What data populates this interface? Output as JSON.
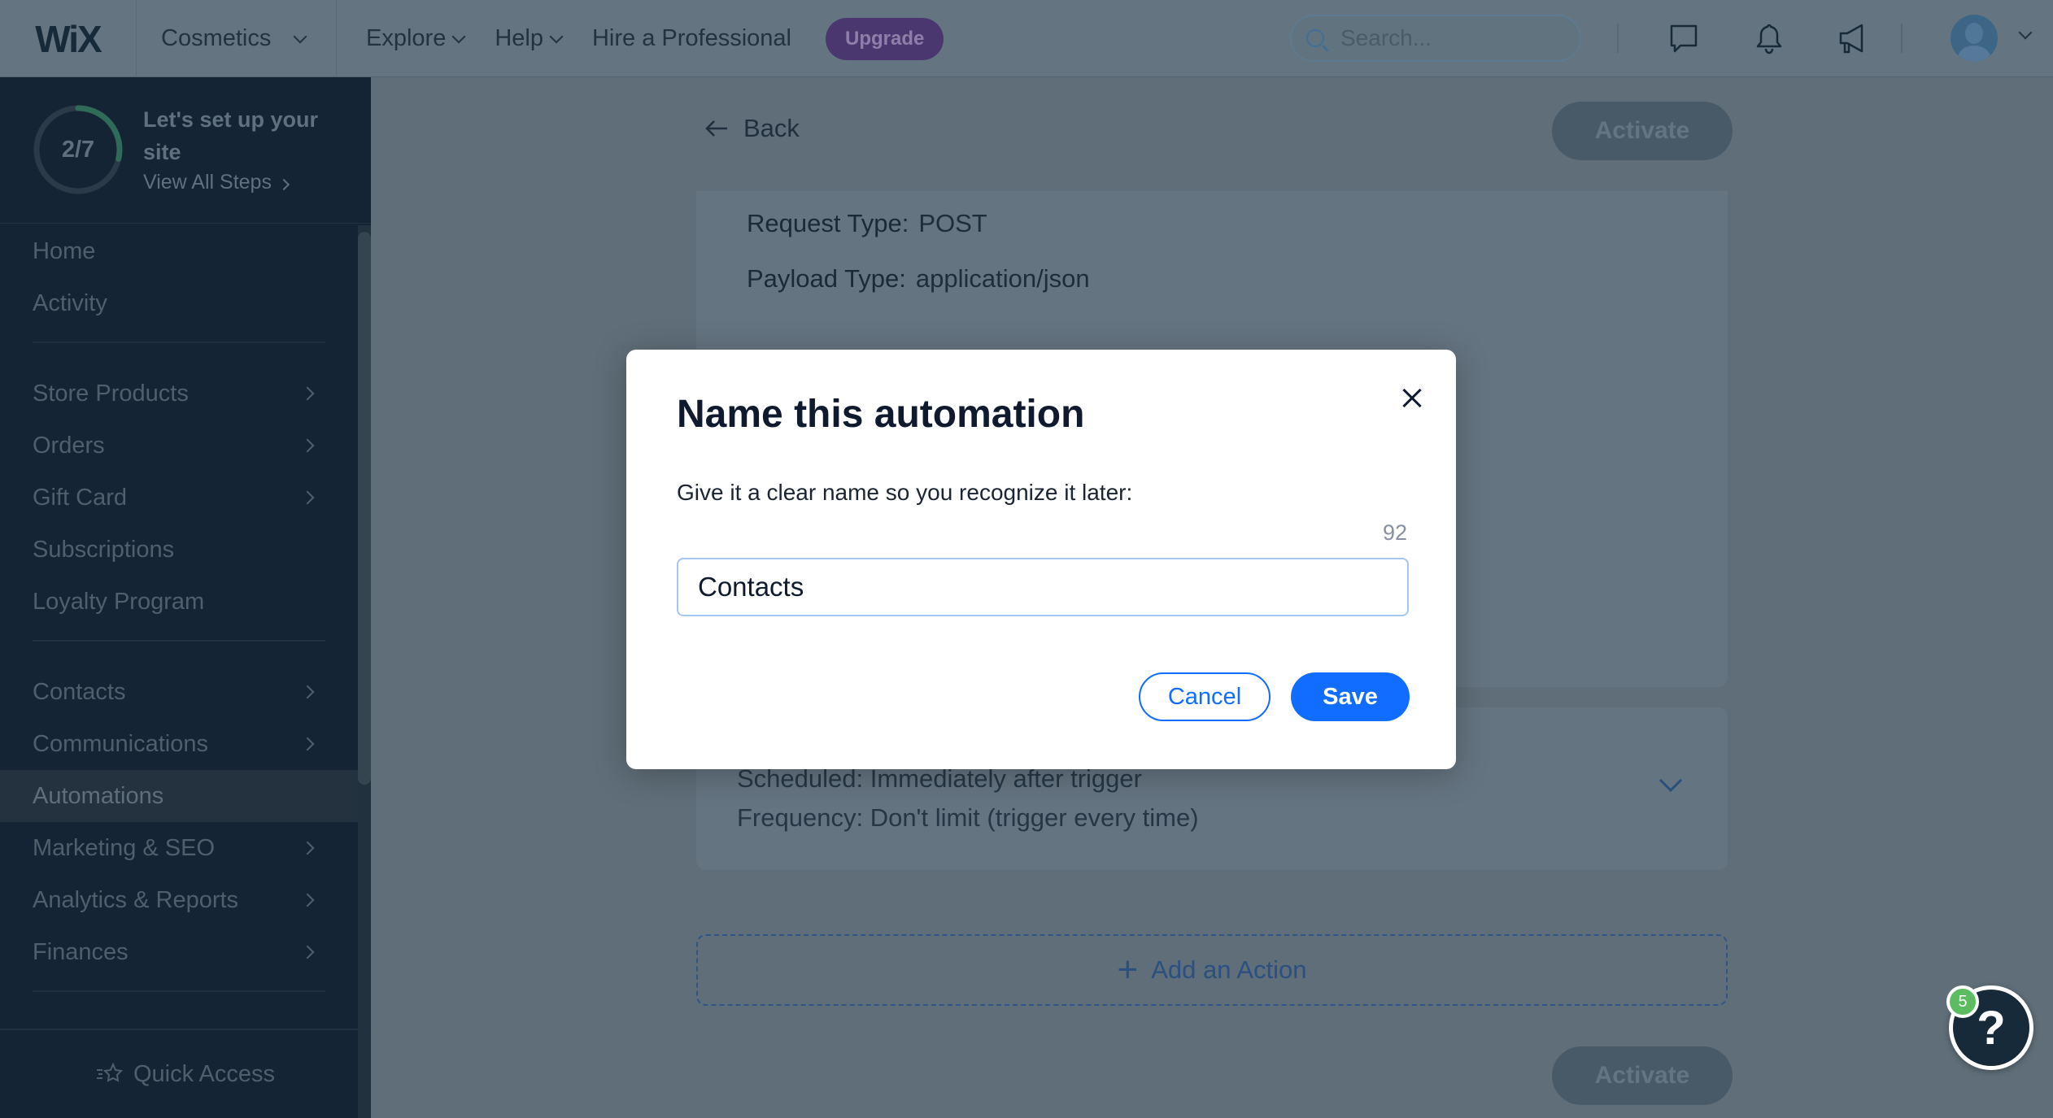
{
  "topbar": {
    "logo": "WiX",
    "site_name": "Cosmetics",
    "nav": [
      {
        "label": "Explore",
        "has_dropdown": true
      },
      {
        "label": "Help",
        "has_dropdown": true
      },
      {
        "label": "Hire a Professional",
        "has_dropdown": false
      }
    ],
    "upgrade_label": "Upgrade",
    "search_placeholder": "Search...",
    "icons": [
      "chat-icon",
      "bell-icon",
      "megaphone-icon",
      "avatar"
    ]
  },
  "sidebar": {
    "setup": {
      "progress_text": "2/7",
      "progress_fraction": 0.2857,
      "title": "Let's set up your site",
      "link_label": "View All Steps"
    },
    "groups": [
      [
        {
          "label": "Home",
          "has_submenu": false
        },
        {
          "label": "Activity",
          "has_submenu": false
        }
      ],
      [
        {
          "label": "Store Products",
          "has_submenu": true
        },
        {
          "label": "Orders",
          "has_submenu": true
        },
        {
          "label": "Gift Card",
          "has_submenu": true
        },
        {
          "label": "Subscriptions",
          "has_submenu": false
        },
        {
          "label": "Loyalty Program",
          "has_submenu": false
        }
      ],
      [
        {
          "label": "Contacts",
          "has_submenu": true
        },
        {
          "label": "Communications",
          "has_submenu": true
        },
        {
          "label": "Automations",
          "has_submenu": false,
          "active": true
        },
        {
          "label": "Marketing & SEO",
          "has_submenu": true
        },
        {
          "label": "Analytics & Reports",
          "has_submenu": true
        },
        {
          "label": "Finances",
          "has_submenu": true
        }
      ]
    ],
    "quick_access_label": "Quick Access"
  },
  "main": {
    "back_label": "Back",
    "activate_label": "Activate",
    "request_type_label": "Request Type:",
    "request_type_value": "POST",
    "payload_type_label": "Payload Type:",
    "payload_type_value": "application/json",
    "scheduled_text": "Scheduled: Immediately after trigger",
    "frequency_text": "Frequency: Don't limit (trigger every time)",
    "add_action_label": "Add an Action"
  },
  "help": {
    "badge_count": "5",
    "glyph": "?"
  },
  "modal": {
    "title": "Name this automation",
    "description": "Give it a clear name so you recognize it later:",
    "char_remaining": "92",
    "input_value": "Contacts",
    "cancel_label": "Cancel",
    "save_label": "Save"
  },
  "colors": {
    "primary": "#116dff",
    "upgrade": "#4b3770",
    "sidebar_bg": "#152434",
    "progress": "#2f6b57",
    "badge": "#5bbd5f"
  }
}
